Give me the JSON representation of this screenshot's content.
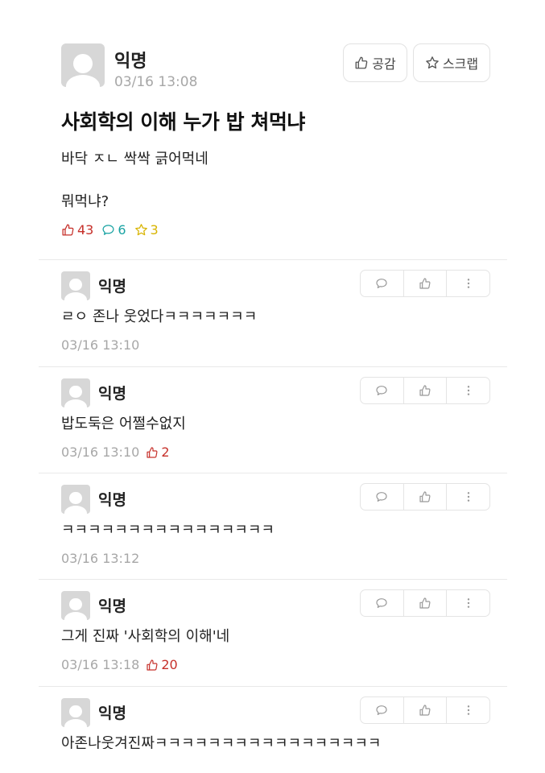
{
  "post": {
    "author": "익명",
    "time": "03/16 13:08",
    "like_button": "공감",
    "scrap_button": "스크랩",
    "title": "사회학의 이해 누가 밥 쳐먹냐",
    "body_line1": "바닥 ㅈㄴ 싹싹 긁어먹네",
    "body_line2": "뭐먹냐?",
    "likes": "43",
    "comments": "6",
    "scraps": "3"
  },
  "comments": [
    {
      "author": "익명",
      "text": "ㄹㅇ 존나 웃었다ㅋㅋㅋㅋㅋㅋㅋ",
      "time": "03/16 13:10",
      "votes": ""
    },
    {
      "author": "익명",
      "text": "밥도둑은 어쩔수없지",
      "time": "03/16 13:10",
      "votes": "2"
    },
    {
      "author": "익명",
      "text": "ㅋㅋㅋㅋㅋㅋㅋㅋㅋㅋㅋㅋㅋㅋㅋㅋ",
      "time": "03/16 13:12",
      "votes": ""
    },
    {
      "author": "익명",
      "text": "그게 진짜 '사회학의 이해'네",
      "time": "03/16 13:18",
      "votes": "20"
    },
    {
      "author": "익명",
      "text": "아존나웃겨진짜ㅋㅋㅋㅋㅋㅋㅋㅋㅋㅋㅋㅋㅋㅋㅋㅋㅋ",
      "time": "",
      "votes": ""
    }
  ],
  "colors": {
    "like": "#c6302a",
    "comment": "#1aa3a3",
    "scrap": "#d8b400",
    "muted": "#a7a7a7"
  },
  "icons": [
    "thumbs-up-icon",
    "star-icon",
    "speech-bubble-icon",
    "more-vertical-icon",
    "avatar-icon"
  ]
}
